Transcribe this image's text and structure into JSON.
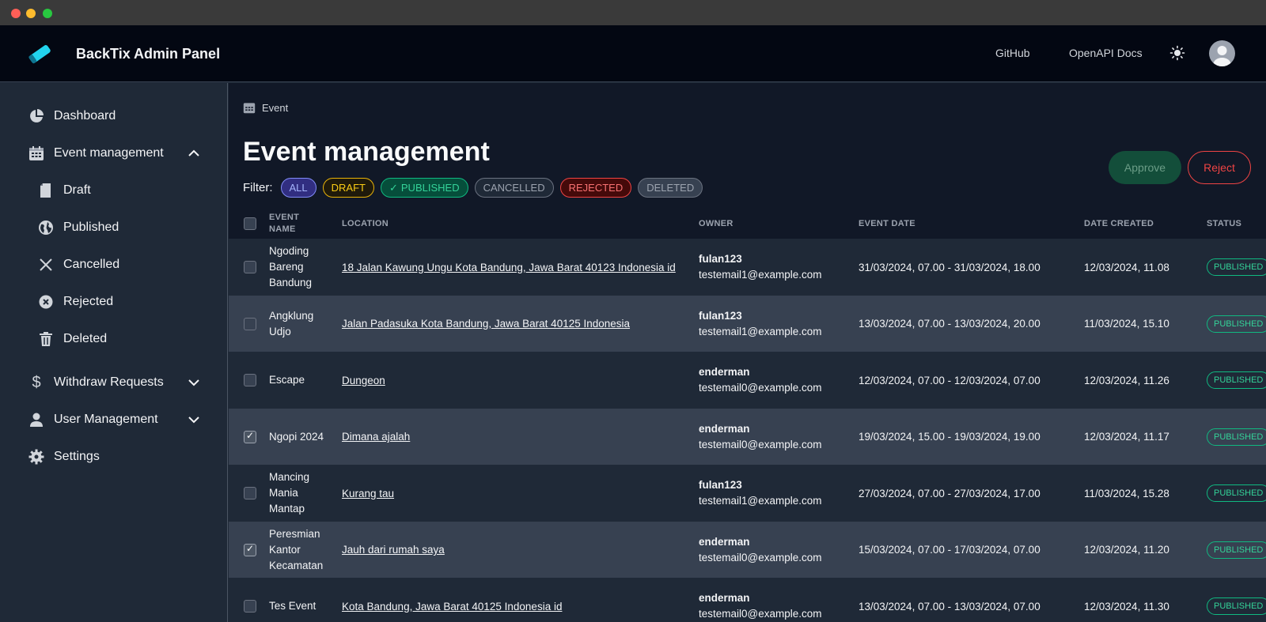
{
  "window": {
    "traffic_lights": [
      "#fe5f57",
      "#febc2e",
      "#28c840"
    ]
  },
  "header": {
    "brand": "BackTix Admin Panel",
    "links": [
      {
        "label": "GitHub"
      },
      {
        "label": "OpenAPI Docs"
      }
    ],
    "theme_icon": "sun-icon",
    "avatar_icon": "user-avatar-icon"
  },
  "sidebar": {
    "items": [
      {
        "label": "Dashboard",
        "icon": "pie-chart-icon"
      },
      {
        "label": "Event management",
        "icon": "calendar-icon",
        "expanded": true
      },
      {
        "label": "Draft",
        "icon": "document-icon"
      },
      {
        "label": "Published",
        "icon": "globe-icon"
      },
      {
        "label": "Cancelled",
        "icon": "x-icon"
      },
      {
        "label": "Rejected",
        "icon": "x-circle-icon"
      },
      {
        "label": "Deleted",
        "icon": "trash-icon"
      },
      {
        "label": "Withdraw Requests",
        "icon": "dollar-icon",
        "expanded": false
      },
      {
        "label": "User Management",
        "icon": "user-icon",
        "expanded": false
      },
      {
        "label": "Settings",
        "icon": "gear-icon"
      }
    ]
  },
  "breadcrumb": {
    "label": "Event",
    "icon": "calendar-icon"
  },
  "page": {
    "title": "Event management"
  },
  "filter": {
    "label": "Filter:",
    "chips": [
      {
        "label": "ALL"
      },
      {
        "label": "DRAFT"
      },
      {
        "label": "PUBLISHED",
        "selected": true
      },
      {
        "label": "CANCELLED"
      },
      {
        "label": "REJECTED"
      },
      {
        "label": "DELETED"
      }
    ]
  },
  "actions": {
    "approve": "Approve",
    "reject": "Reject"
  },
  "table": {
    "headers": {
      "event_name": "EVENT NAME",
      "location": "LOCATION",
      "owner": "OWNER",
      "event_date": "EVENT DATE",
      "date_created": "DATE CREATED",
      "status": "STATUS"
    },
    "rows": [
      {
        "name": "Ngoding Bareng Bandung",
        "location": "18 Jalan Kawung Ungu Kota Bandung, Jawa Barat 40123 Indonesia id",
        "owner": "fulan123",
        "email": "testemail1@example.com",
        "event_date": "31/03/2024, 07.00 - 31/03/2024, 18.00",
        "created": "12/03/2024, 11.08",
        "status": "PUBLISHED",
        "checked": false
      },
      {
        "name": "Angklung Udjo",
        "location": "Jalan Padasuka Kota Bandung, Jawa Barat 40125 Indonesia",
        "owner": "fulan123",
        "email": "testemail1@example.com",
        "event_date": "13/03/2024, 07.00 - 13/03/2024, 20.00",
        "created": "11/03/2024, 15.10",
        "status": "PUBLISHED",
        "checked": false
      },
      {
        "name": "Escape",
        "location": "Dungeon",
        "owner": "enderman",
        "email": "testemail0@example.com",
        "event_date": "12/03/2024, 07.00 - 12/03/2024, 07.00",
        "created": "12/03/2024, 11.26",
        "status": "PUBLISHED",
        "checked": false
      },
      {
        "name": "Ngopi 2024",
        "location": "Dimana ajalah",
        "owner": "enderman",
        "email": "testemail0@example.com",
        "event_date": "19/03/2024, 15.00 - 19/03/2024, 19.00",
        "created": "12/03/2024, 11.17",
        "status": "PUBLISHED",
        "checked": true
      },
      {
        "name": "Mancing Mania Mantap",
        "location": "Kurang tau",
        "owner": "fulan123",
        "email": "testemail1@example.com",
        "event_date": "27/03/2024, 07.00 - 27/03/2024, 17.00",
        "created": "11/03/2024, 15.28",
        "status": "PUBLISHED",
        "checked": false
      },
      {
        "name": "Peresmian Kantor Kecamatan",
        "location": "Jauh dari rumah saya",
        "owner": "enderman",
        "email": "testemail0@example.com",
        "event_date": "15/03/2024, 07.00 - 17/03/2024, 07.00",
        "created": "12/03/2024, 11.20",
        "status": "PUBLISHED",
        "checked": true
      },
      {
        "name": "Tes Event",
        "location": "Kota Bandung, Jawa Barat 40125 Indonesia id",
        "owner": "enderman",
        "email": "testemail0@example.com",
        "event_date": "13/03/2024, 07.00 - 13/03/2024, 07.00",
        "created": "12/03/2024, 11.30",
        "status": "PUBLISHED",
        "checked": false
      }
    ]
  }
}
